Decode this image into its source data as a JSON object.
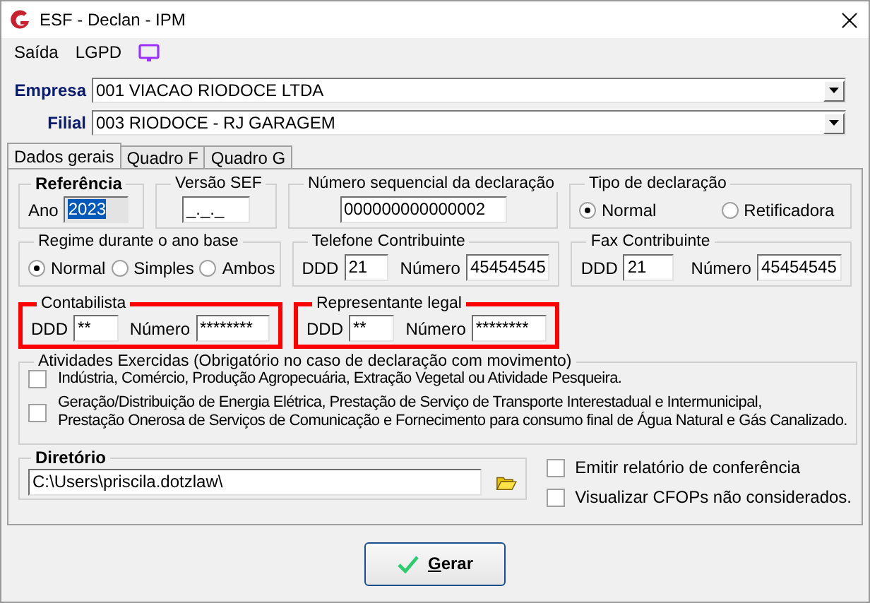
{
  "window": {
    "title": "ESF - Declan - IPM"
  },
  "menu": [
    {
      "label": "Saída"
    },
    {
      "label": "LGPD"
    }
  ],
  "selectors": [
    {
      "label": "Empresa",
      "value": "001 VIACAO RIODOCE LTDA"
    },
    {
      "label": "Filial",
      "value": "003 RIODOCE - RJ GARAGEM"
    }
  ],
  "tabs": [
    {
      "label": "Dados gerais",
      "selected": true
    },
    {
      "label": "Quadro F",
      "selected": false
    },
    {
      "label": "Quadro G",
      "selected": false
    }
  ],
  "referencia": {
    "title": "Referência",
    "label": "Ano",
    "value": "2023",
    "text_selected": true
  },
  "versao_sef": {
    "title": "Versão SEF",
    "value": "_._._"
  },
  "numero_sequencial": {
    "title": "Número sequencial da declaração",
    "value": "000000000000002"
  },
  "tipo_declaracao": {
    "title": "Tipo de declaração",
    "options": [
      {
        "label": "Normal",
        "selected": true
      },
      {
        "label": "Retificadora",
        "selected": false
      }
    ]
  },
  "regime": {
    "title": "Regime durante o ano base",
    "options": [
      {
        "label": "Normal",
        "selected": true
      },
      {
        "label": "Simples",
        "selected": false
      },
      {
        "label": "Ambos",
        "selected": false
      }
    ]
  },
  "contacts": [
    {
      "title": "Telefone Contribuinte",
      "ddd_label": "DDD",
      "ddd": "21",
      "numero_label": "Número",
      "numero": "45454545",
      "highlighted": false
    },
    {
      "title": "Fax Contribuinte",
      "ddd_label": "DDD",
      "ddd": "21",
      "numero_label": "Número",
      "numero": "45454545",
      "highlighted": false
    },
    {
      "title": "Contabilista",
      "ddd_label": "DDD",
      "ddd": "**",
      "numero_label": "Número",
      "numero": "********",
      "highlighted": true
    },
    {
      "title": "Representante legal",
      "ddd_label": "DDD",
      "ddd": "**",
      "numero_label": "Número",
      "numero": "********",
      "highlighted": true
    }
  ],
  "atividades": {
    "title": "Atividades Exercidas (Obrigatório no caso de declaração com movimento)",
    "items": [
      {
        "label": "Indústria, Comércio, Produção Agropecuária, Extração Vegetal ou Atividade Pesqueira.",
        "checked": false
      },
      {
        "label_lines": [
          "Geração/Distribuição de Energia Elétrica, Prestação de Serviço de Transporte Interestadual e Intermunicipal,",
          "Prestação Onerosa de Serviços de Comunicação e Fornecimento para consumo final de Água Natural e Gás Canalizado."
        ],
        "checked": false
      }
    ]
  },
  "diretorio": {
    "title": "Diretório",
    "value": "C:\\Users\\priscila.dotzlaw\\"
  },
  "options": [
    {
      "label": "Emitir relatório de conferência",
      "checked": false
    },
    {
      "label": "Visualizar CFOPs não considerados.",
      "checked": false
    }
  ],
  "primary_button": {
    "label": "Gerar",
    "access_key_underlined": true
  }
}
